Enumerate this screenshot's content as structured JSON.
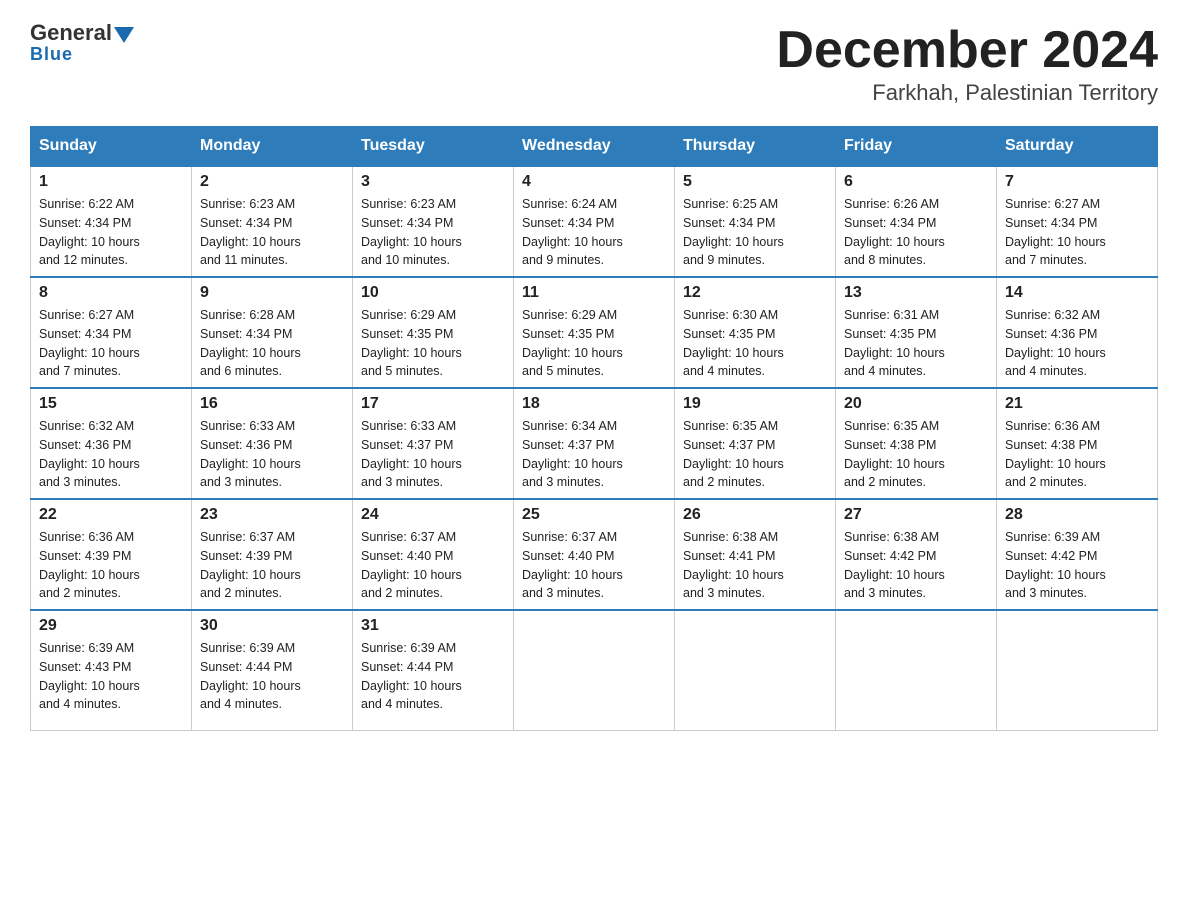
{
  "header": {
    "logo_general": "General",
    "logo_blue": "Blue",
    "title": "December 2024",
    "subtitle": "Farkhah, Palestinian Territory"
  },
  "days_of_week": [
    "Sunday",
    "Monday",
    "Tuesday",
    "Wednesday",
    "Thursday",
    "Friday",
    "Saturday"
  ],
  "weeks": [
    [
      {
        "day": "1",
        "sunrise": "6:22 AM",
        "sunset": "4:34 PM",
        "daylight": "10 hours and 12 minutes."
      },
      {
        "day": "2",
        "sunrise": "6:23 AM",
        "sunset": "4:34 PM",
        "daylight": "10 hours and 11 minutes."
      },
      {
        "day": "3",
        "sunrise": "6:23 AM",
        "sunset": "4:34 PM",
        "daylight": "10 hours and 10 minutes."
      },
      {
        "day": "4",
        "sunrise": "6:24 AM",
        "sunset": "4:34 PM",
        "daylight": "10 hours and 9 minutes."
      },
      {
        "day": "5",
        "sunrise": "6:25 AM",
        "sunset": "4:34 PM",
        "daylight": "10 hours and 9 minutes."
      },
      {
        "day": "6",
        "sunrise": "6:26 AM",
        "sunset": "4:34 PM",
        "daylight": "10 hours and 8 minutes."
      },
      {
        "day": "7",
        "sunrise": "6:27 AM",
        "sunset": "4:34 PM",
        "daylight": "10 hours and 7 minutes."
      }
    ],
    [
      {
        "day": "8",
        "sunrise": "6:27 AM",
        "sunset": "4:34 PM",
        "daylight": "10 hours and 7 minutes."
      },
      {
        "day": "9",
        "sunrise": "6:28 AM",
        "sunset": "4:34 PM",
        "daylight": "10 hours and 6 minutes."
      },
      {
        "day": "10",
        "sunrise": "6:29 AM",
        "sunset": "4:35 PM",
        "daylight": "10 hours and 5 minutes."
      },
      {
        "day": "11",
        "sunrise": "6:29 AM",
        "sunset": "4:35 PM",
        "daylight": "10 hours and 5 minutes."
      },
      {
        "day": "12",
        "sunrise": "6:30 AM",
        "sunset": "4:35 PM",
        "daylight": "10 hours and 4 minutes."
      },
      {
        "day": "13",
        "sunrise": "6:31 AM",
        "sunset": "4:35 PM",
        "daylight": "10 hours and 4 minutes."
      },
      {
        "day": "14",
        "sunrise": "6:32 AM",
        "sunset": "4:36 PM",
        "daylight": "10 hours and 4 minutes."
      }
    ],
    [
      {
        "day": "15",
        "sunrise": "6:32 AM",
        "sunset": "4:36 PM",
        "daylight": "10 hours and 3 minutes."
      },
      {
        "day": "16",
        "sunrise": "6:33 AM",
        "sunset": "4:36 PM",
        "daylight": "10 hours and 3 minutes."
      },
      {
        "day": "17",
        "sunrise": "6:33 AM",
        "sunset": "4:37 PM",
        "daylight": "10 hours and 3 minutes."
      },
      {
        "day": "18",
        "sunrise": "6:34 AM",
        "sunset": "4:37 PM",
        "daylight": "10 hours and 3 minutes."
      },
      {
        "day": "19",
        "sunrise": "6:35 AM",
        "sunset": "4:37 PM",
        "daylight": "10 hours and 2 minutes."
      },
      {
        "day": "20",
        "sunrise": "6:35 AM",
        "sunset": "4:38 PM",
        "daylight": "10 hours and 2 minutes."
      },
      {
        "day": "21",
        "sunrise": "6:36 AM",
        "sunset": "4:38 PM",
        "daylight": "10 hours and 2 minutes."
      }
    ],
    [
      {
        "day": "22",
        "sunrise": "6:36 AM",
        "sunset": "4:39 PM",
        "daylight": "10 hours and 2 minutes."
      },
      {
        "day": "23",
        "sunrise": "6:37 AM",
        "sunset": "4:39 PM",
        "daylight": "10 hours and 2 minutes."
      },
      {
        "day": "24",
        "sunrise": "6:37 AM",
        "sunset": "4:40 PM",
        "daylight": "10 hours and 2 minutes."
      },
      {
        "day": "25",
        "sunrise": "6:37 AM",
        "sunset": "4:40 PM",
        "daylight": "10 hours and 3 minutes."
      },
      {
        "day": "26",
        "sunrise": "6:38 AM",
        "sunset": "4:41 PM",
        "daylight": "10 hours and 3 minutes."
      },
      {
        "day": "27",
        "sunrise": "6:38 AM",
        "sunset": "4:42 PM",
        "daylight": "10 hours and 3 minutes."
      },
      {
        "day": "28",
        "sunrise": "6:39 AM",
        "sunset": "4:42 PM",
        "daylight": "10 hours and 3 minutes."
      }
    ],
    [
      {
        "day": "29",
        "sunrise": "6:39 AM",
        "sunset": "4:43 PM",
        "daylight": "10 hours and 4 minutes."
      },
      {
        "day": "30",
        "sunrise": "6:39 AM",
        "sunset": "4:44 PM",
        "daylight": "10 hours and 4 minutes."
      },
      {
        "day": "31",
        "sunrise": "6:39 AM",
        "sunset": "4:44 PM",
        "daylight": "10 hours and 4 minutes."
      },
      null,
      null,
      null,
      null
    ]
  ],
  "labels": {
    "sunrise": "Sunrise:",
    "sunset": "Sunset:",
    "daylight": "Daylight:"
  }
}
